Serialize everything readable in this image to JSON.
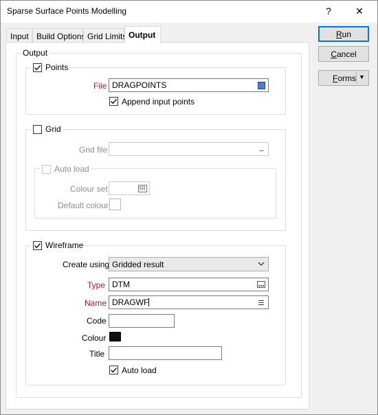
{
  "window": {
    "title": "Sparse Surface Points Modelling",
    "help_label": "?",
    "close_label": "✕"
  },
  "tabs": [
    {
      "label": "Input",
      "active": false
    },
    {
      "label": "Build Options",
      "active": false
    },
    {
      "label": "Grid Limits",
      "active": false
    },
    {
      "label": "Output",
      "active": true
    }
  ],
  "buttons": {
    "run_first": "R",
    "run_rest": "un",
    "cancel_first": "C",
    "cancel_rest": "ancel",
    "forms_first": "F",
    "forms_rest": "orms",
    "forms_arrow": "▼"
  },
  "output": {
    "legend": "Output",
    "points": {
      "label": "Points",
      "checked": true,
      "file_label": "File",
      "file_value": "DRAGPOINTS",
      "append_label": "Append input points",
      "append_checked": true
    },
    "grid": {
      "label": "Grid",
      "checked": false,
      "grid_file_label": "Grid file",
      "grid_file_value": "",
      "browse_label": "...",
      "autoload_label": "Auto load",
      "autoload_checked": false,
      "colour_set_label": "Colour set",
      "default_colour_label": "Default colour"
    },
    "wireframe": {
      "label": "Wireframe",
      "checked": true,
      "create_using_label": "Create using",
      "create_using_value": "Gridded result",
      "type_label": "Type",
      "type_value": "DTM",
      "name_label": "Name",
      "name_value": "DRAGWF",
      "code_label": "Code",
      "code_value": "",
      "colour_label": "Colour",
      "colour_value": "#111111",
      "title_label": "Title",
      "title_value": "",
      "autoload_label": "Auto load",
      "autoload_checked": true
    }
  },
  "colors": {
    "accent": "#0078d7",
    "required_label": "#b0171f",
    "file_icon": "#4a7fd4"
  }
}
